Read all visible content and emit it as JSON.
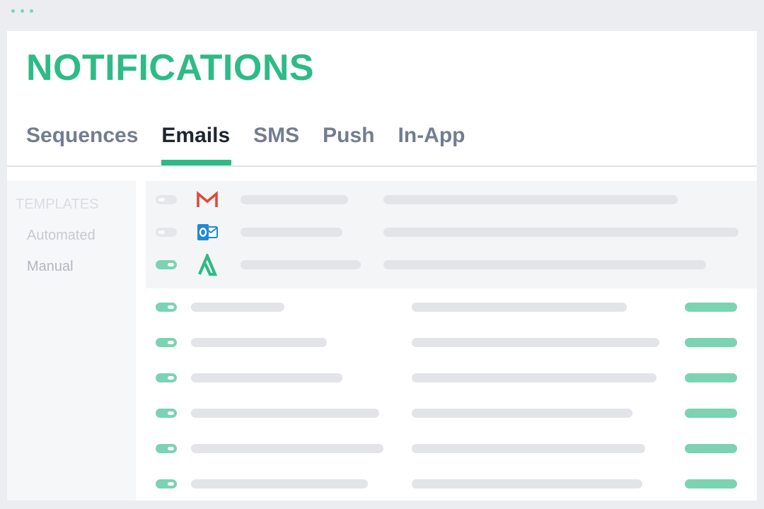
{
  "app": {
    "title": "NOTIFICATIONS",
    "accent_color": "#2dbb86",
    "toggle_color": "#7bd3b4"
  },
  "tabs": [
    {
      "label": "Sequences",
      "active": false
    },
    {
      "label": "Emails",
      "active": true
    },
    {
      "label": "SMS",
      "active": false
    },
    {
      "label": "Push",
      "active": false
    },
    {
      "label": "In-App",
      "active": false
    }
  ],
  "sidebar": {
    "heading": "TEMPLATES",
    "items": [
      {
        "label": "Automated"
      },
      {
        "label": "Manual"
      }
    ]
  },
  "providers": [
    {
      "icon": "gmail-icon",
      "enabled": false
    },
    {
      "icon": "outlook-icon",
      "enabled": false
    },
    {
      "icon": "provider-a-icon",
      "enabled": true
    }
  ],
  "templates": [
    {
      "enabled": true
    },
    {
      "enabled": true
    },
    {
      "enabled": true
    },
    {
      "enabled": true
    },
    {
      "enabled": true
    },
    {
      "enabled": true
    }
  ]
}
